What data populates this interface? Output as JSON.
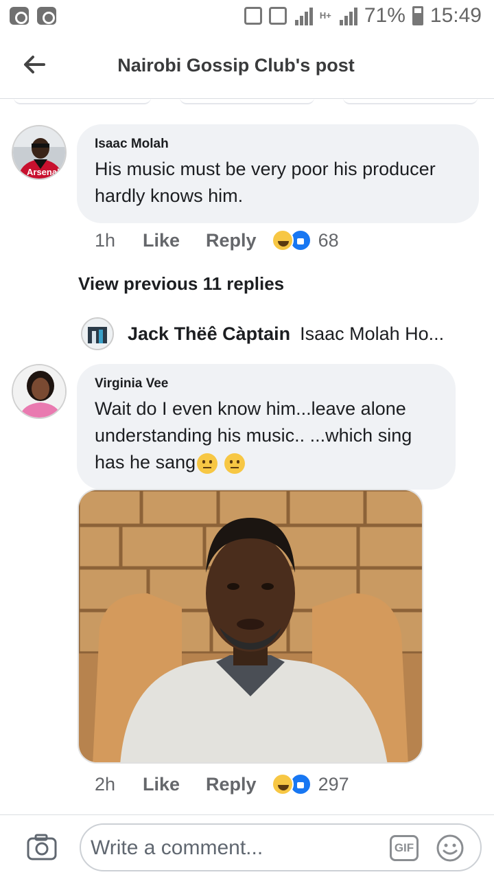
{
  "status_bar": {
    "battery": "71%",
    "time": "15:49",
    "network": "H+"
  },
  "header": {
    "title": "Nairobi Gossip Club's post"
  },
  "comments": [
    {
      "author": "Isaac Molah",
      "avatar_text": "Arsenal",
      "text": "His music must be very poor his producer hardly knows him.",
      "time": "1h",
      "like_label": "Like",
      "reply_label": "Reply",
      "reaction_count": "68"
    },
    {
      "author": "Virginia Vee",
      "text": "Wait do I even know him...leave alone understanding his music.. ...which sing has he sang",
      "time": "2h",
      "like_label": "Like",
      "reply_label": "Reply",
      "reaction_count": "297"
    }
  ],
  "view_previous": "View previous 11 replies",
  "reply_preview": {
    "author": "Jack Thëê Càptain",
    "text": "Isaac Molah Ho..."
  },
  "composer": {
    "placeholder": "Write a comment...",
    "gif_label": "GIF"
  },
  "icons": {
    "back": "arrow-left-icon",
    "camera": "camera-icon",
    "emoji": "smiley-icon",
    "reaction_haha": "haha-reaction-icon",
    "reaction_like": "like-reaction-icon"
  },
  "colors": {
    "like_blue": "#1877f2",
    "bubble_bg": "#f0f2f5",
    "secondary_text": "#65676b"
  }
}
